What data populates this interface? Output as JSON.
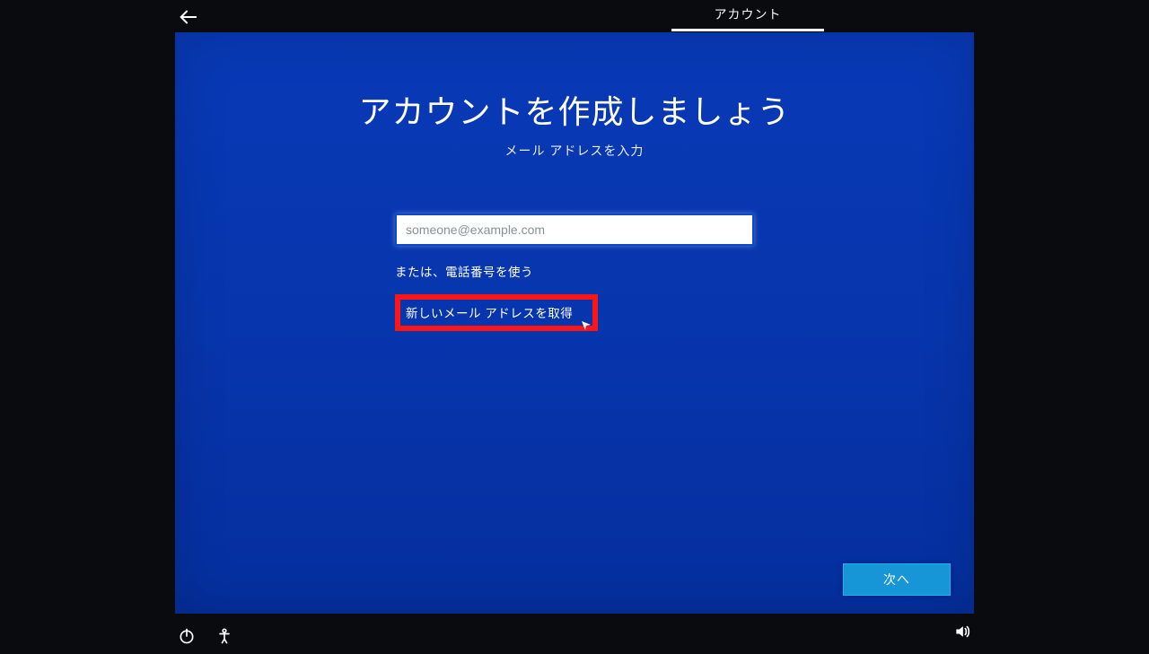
{
  "header": {
    "tab_label": "アカウント"
  },
  "main": {
    "title": "アカウントを作成しましょう",
    "subtitle": "メール アドレスを入力",
    "email_placeholder": "someone@example.com",
    "link_use_phone": "または、電話番号を使う",
    "link_new_email": "新しいメール アドレスを取得",
    "next_button": "次へ"
  },
  "colors": {
    "panel_bg": "#0735ad",
    "highlight_border": "#ff1515",
    "next_button_bg": "#1696d6"
  }
}
